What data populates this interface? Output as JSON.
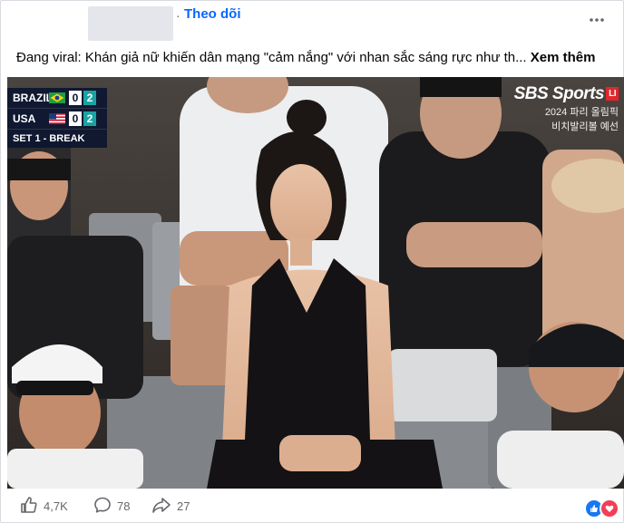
{
  "header": {
    "separator": "·",
    "follow_label": "Theo dõi"
  },
  "post": {
    "text": "Đang viral: Khán giả nữ khiến dân mạng \"cảm nắng\" với nhan sắc sáng rực như th...",
    "see_more": "Xem thêm"
  },
  "overlay": {
    "score_rows": [
      {
        "team": "BRAZIL",
        "flag": "brazil-flag-icon",
        "sets": "0",
        "games": "2"
      },
      {
        "team": "USA",
        "flag": "usa-flag-icon",
        "sets": "0",
        "games": "2"
      }
    ],
    "set_status": "SET 1 - BREAK",
    "broadcaster_logo": "SBS Sports",
    "live_badge": "LI",
    "broadcaster_line1": "2024 파리 올림픽",
    "broadcaster_line2": "비치발리볼 예선"
  },
  "footer": {
    "likes": "4,7K",
    "comments": "78",
    "shares": "27",
    "like_icon": "thumbs-up-icon",
    "comment_icon": "comment-bubble-icon",
    "share_icon": "share-arrow-icon"
  },
  "colors": {
    "accent": "#0866ff",
    "like_blue": "#1877f2",
    "love_red": "#f33e58"
  }
}
